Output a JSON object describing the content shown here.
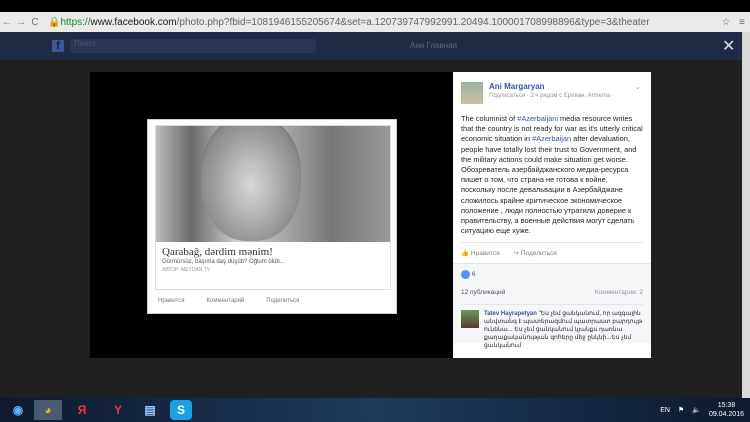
{
  "browser": {
    "url_scheme": "https://",
    "url_host": "www.facebook.com",
    "url_path": "/photo.php?fbid=1081946155205674&set=a.120739747992991.20494.100001708998896&type=3&theater"
  },
  "fb": {
    "search_placeholder": "Поиск",
    "nav": "Ани   Главная"
  },
  "shared_card": {
    "title": "Qarabağ, dərdim mənim!",
    "description": "Görmürsüz, başıma daş düşüb? Oğlum ölüb...",
    "author": "АВТОР: MEYDAN.TV",
    "actions": [
      "Нравится",
      "Комментарий",
      "Поделиться"
    ]
  },
  "post": {
    "author": "Ani Margaryan",
    "meta": "Подписаться · 2 ч рядом с Ереван, Armenia · ",
    "text_en_1": "The columnist of ",
    "tag1": "#Azerbaijani",
    "text_en_2": " media resource writes that the country is not ready for war as it's utterly critical economic situation in ",
    "tag2": "#Azerbaijan",
    "text_en_3": " after devaluation, people have totally lost their trust to Government, and the military actions could make situation get worse.",
    "text_ru": "Обозреватель азербайджанского медиа-ресурса пишет о том, что страна не готова к войне, поскольку после девальвации в Азербайджане сложилось крайне критическое экономическое положение , люди полностью утратили доверие к правительству, а военные действия могут сделать ситуацию еще хуже.",
    "like_label": "Нравится",
    "share_label": "Поделиться",
    "likes_count": "6",
    "shares": "12 публикаций",
    "comments": "Комментарии: 2"
  },
  "comment": {
    "author": "Tatev Hayrapetyan",
    "text": "\"Ես չեմ ցանկանում, որ ազգային անվտանգ է պատերազմում պատրաստ բարդույթ ունենա... Ես չեմ ցանկանում կյանքս դառնա քաղաքականության զոհերը մեջ ընկնի...Ես չեմ ցանկանում"
  },
  "taskbar": {
    "lang": "EN",
    "time": "15:38",
    "date": "09.04.2016"
  }
}
